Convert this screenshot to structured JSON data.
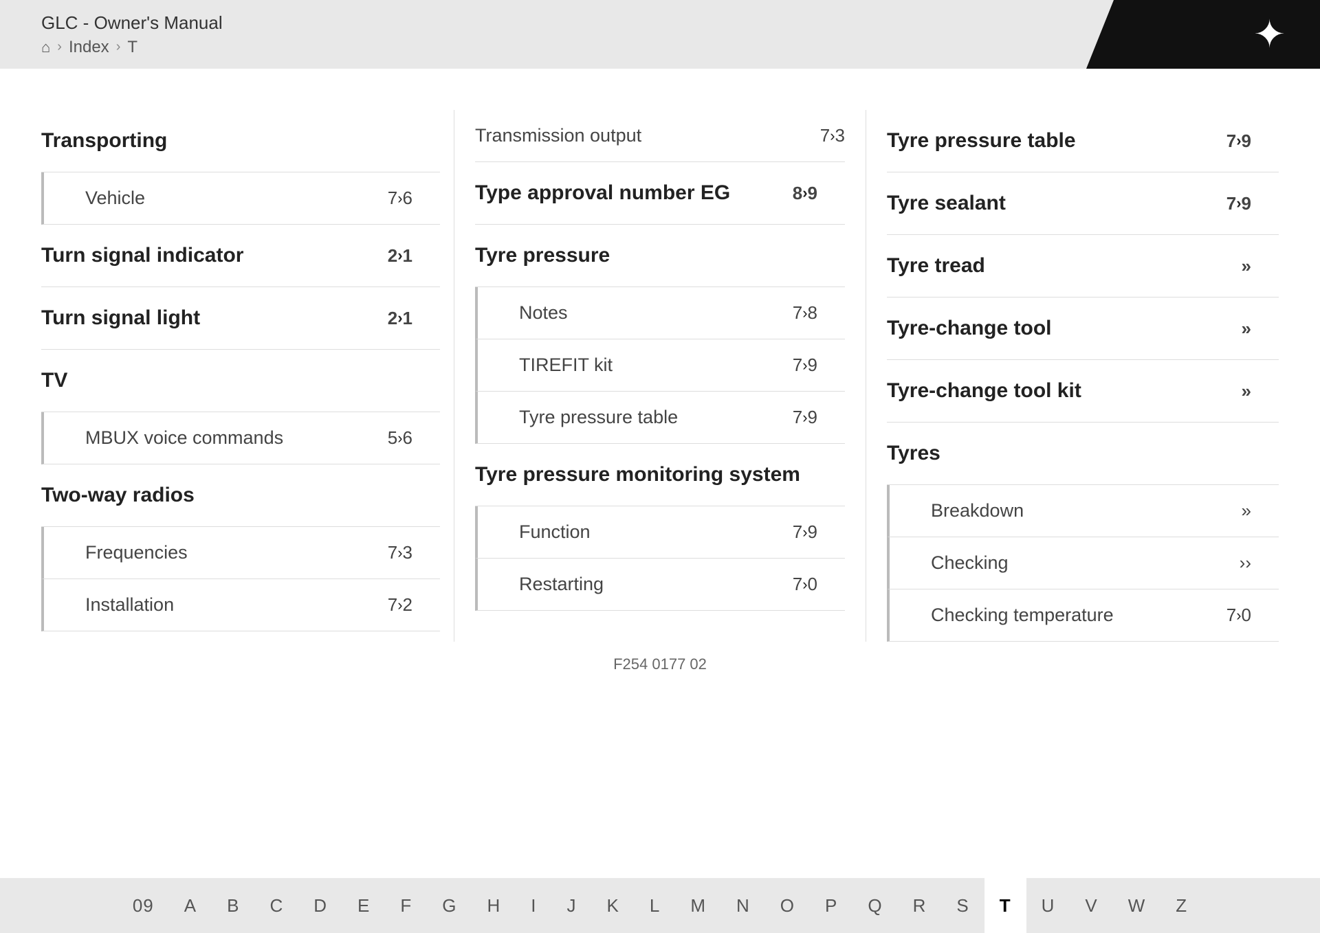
{
  "header": {
    "title": "GLC - Owner's Manual",
    "breadcrumb": [
      "Index",
      "T"
    ],
    "doc_number": "F254 0177 02"
  },
  "alphabet": [
    "09",
    "A",
    "B",
    "C",
    "D",
    "E",
    "F",
    "G",
    "H",
    "I",
    "J",
    "K",
    "L",
    "M",
    "N",
    "O",
    "P",
    "Q",
    "R",
    "S",
    "T",
    "U",
    "V",
    "W",
    "Z"
  ],
  "active_letter": "T",
  "columns": {
    "col1": {
      "sections": [
        {
          "type": "header",
          "label": "Transporting",
          "page": ""
        },
        {
          "type": "sub-item",
          "label": "Vehicle",
          "page": "7›6"
        },
        {
          "type": "header",
          "label": "Turn signal indicator",
          "page": "2›1"
        },
        {
          "type": "header",
          "label": "Turn signal light",
          "page": "2›1"
        },
        {
          "type": "header",
          "label": "TV",
          "page": ""
        },
        {
          "type": "sub-item",
          "label": "MBUX voice commands",
          "page": "5›6"
        },
        {
          "type": "header",
          "label": "Two-way radios",
          "page": ""
        },
        {
          "type": "sub-item",
          "label": "Frequencies",
          "page": "7›3"
        },
        {
          "type": "sub-item",
          "label": "Installation",
          "page": "7›2"
        }
      ]
    },
    "col2": {
      "sections": [
        {
          "type": "item",
          "label": "Transmission output",
          "page": "7›3"
        },
        {
          "type": "header",
          "label": "Type approval number EG",
          "page": "8›9"
        },
        {
          "type": "header",
          "label": "Tyre pressure",
          "page": ""
        },
        {
          "type": "sub-item",
          "label": "Notes",
          "page": "7›8"
        },
        {
          "type": "sub-item",
          "label": "TIREFIT kit",
          "page": "7›9"
        },
        {
          "type": "sub-item",
          "label": "Tyre pressure table",
          "page": "7›9"
        },
        {
          "type": "header",
          "label": "Tyre pressure monitoring system",
          "page": ""
        },
        {
          "type": "sub-item",
          "label": "Function",
          "page": "7›9"
        },
        {
          "type": "sub-item",
          "label": "Restarting",
          "page": "7›0"
        }
      ]
    },
    "col3": {
      "sections": [
        {
          "type": "header",
          "label": "Tyre pressure table",
          "page": "7›9"
        },
        {
          "type": "header",
          "label": "Tyre sealant",
          "page": "7›9"
        },
        {
          "type": "header",
          "label": "Tyre tread",
          "page": "»"
        },
        {
          "type": "header",
          "label": "Tyre-change tool",
          "page": "»"
        },
        {
          "type": "header",
          "label": "Tyre-change tool kit",
          "page": "»"
        },
        {
          "type": "header",
          "label": "Tyres",
          "page": ""
        },
        {
          "type": "sub-item",
          "label": "Breakdown",
          "page": "»"
        },
        {
          "type": "sub-item",
          "label": "Checking",
          "page": "›"
        },
        {
          "type": "sub-item",
          "label": "Checking temperature",
          "page": "7›0"
        }
      ]
    }
  }
}
